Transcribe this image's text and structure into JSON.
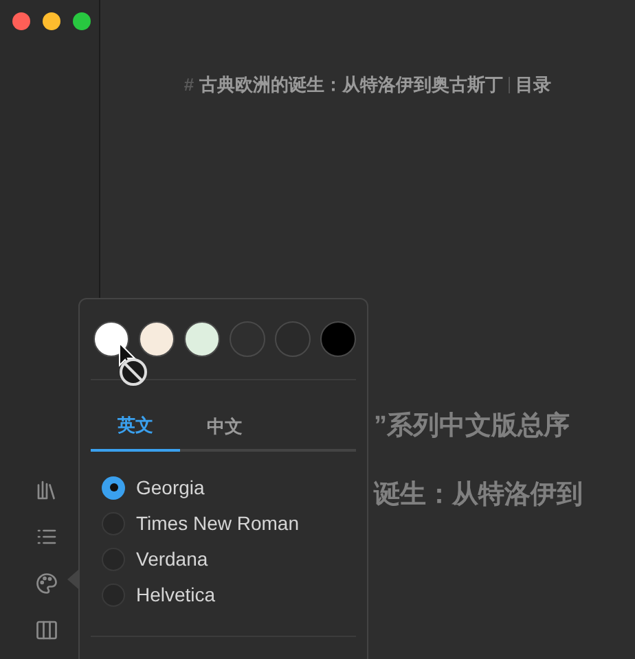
{
  "window": {
    "title_mark": "#",
    "title": "古典欧洲的诞生：从特洛伊到奥古斯丁",
    "section": "目录"
  },
  "content": {
    "lines": [
      "”系列中文版总序",
      "诞生：从特洛伊到"
    ]
  },
  "sidebar": {
    "items": [
      {
        "kind": "books"
      },
      {
        "kind": "list"
      },
      {
        "kind": "palette"
      },
      {
        "kind": "columns"
      }
    ]
  },
  "theme_popover": {
    "swatches": [
      {
        "color": "#ffffff"
      },
      {
        "color": "#f7ebdd"
      },
      {
        "color": "#deefdf"
      },
      {
        "color": "#2f2f2f"
      },
      {
        "color": "#2a2a2a"
      },
      {
        "color": "#000000"
      }
    ],
    "tabs": [
      {
        "label": "英文",
        "selected": true
      },
      {
        "label": "中文",
        "selected": false
      }
    ],
    "fonts": [
      {
        "label": "Georgia",
        "selected": true
      },
      {
        "label": "Times New Roman",
        "selected": false
      },
      {
        "label": "Verdana",
        "selected": false
      },
      {
        "label": "Helvetica",
        "selected": false
      }
    ]
  }
}
